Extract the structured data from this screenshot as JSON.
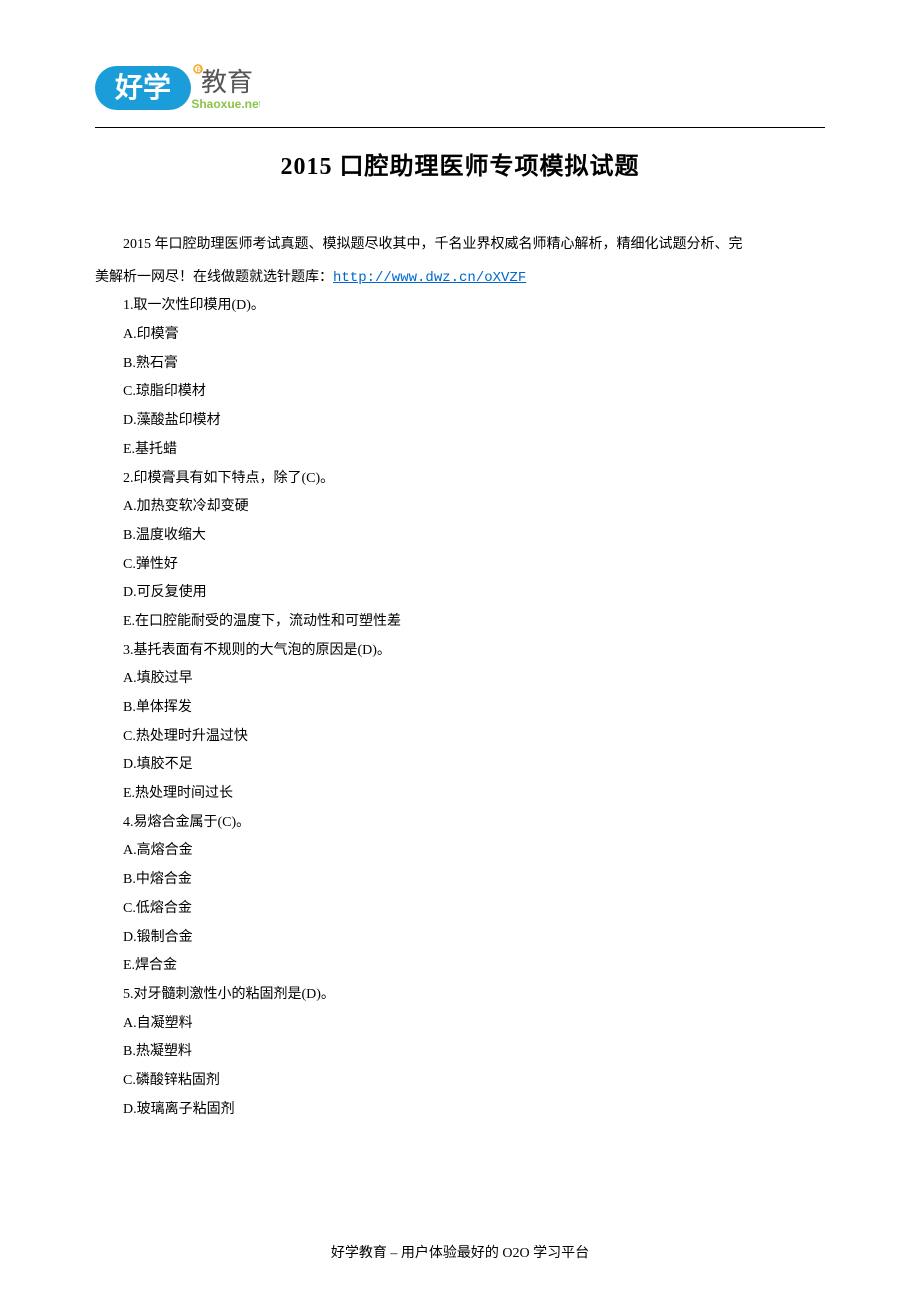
{
  "logo": {
    "main_text": "好学",
    "sub_text": "教育",
    "domain": "Shaoxue.net"
  },
  "title": "2015 口腔助理医师专项模拟试题",
  "intro": {
    "line1": "2015 年口腔助理医师考试真题、模拟题尽收其中，千名业界权威名师精心解析，精细化试题分析、完",
    "line2_prefix": "美解析一网尽！在线做题就选针题库：",
    "link_text": "http://www.dwz.cn/oXVZF"
  },
  "questions": [
    {
      "q": "1.取一次性印模用(D)。",
      "opts": [
        "A.印模膏",
        "B.熟石膏",
        "C.琼脂印模材",
        "D.藻酸盐印模材",
        "E.基托蜡"
      ]
    },
    {
      "q": "2.印模膏具有如下特点，除了(C)。",
      "opts": [
        "A.加热变软冷却变硬",
        "B.温度收缩大",
        "C.弹性好",
        "D.可反复使用",
        "E.在口腔能耐受的温度下，流动性和可塑性差"
      ]
    },
    {
      "q": "3.基托表面有不规则的大气泡的原因是(D)。",
      "opts": [
        "A.填胶过早",
        "B.单体挥发",
        "C.热处理时升温过快",
        "D.填胶不足",
        "E.热处理时间过长"
      ]
    },
    {
      "q": "4.易熔合金属于(C)。",
      "opts": [
        "A.高熔合金",
        "B.中熔合金",
        "C.低熔合金",
        "D.锻制合金",
        "E.焊合金"
      ]
    },
    {
      "q": "5.对牙髓刺激性小的粘固剂是(D)。",
      "opts": [
        "A.自凝塑料",
        "B.热凝塑料",
        "C.磷酸锌粘固剂",
        "D.玻璃离子粘固剂"
      ]
    }
  ],
  "footer": "好学教育  –  用户体验最好的 O2O 学习平台"
}
